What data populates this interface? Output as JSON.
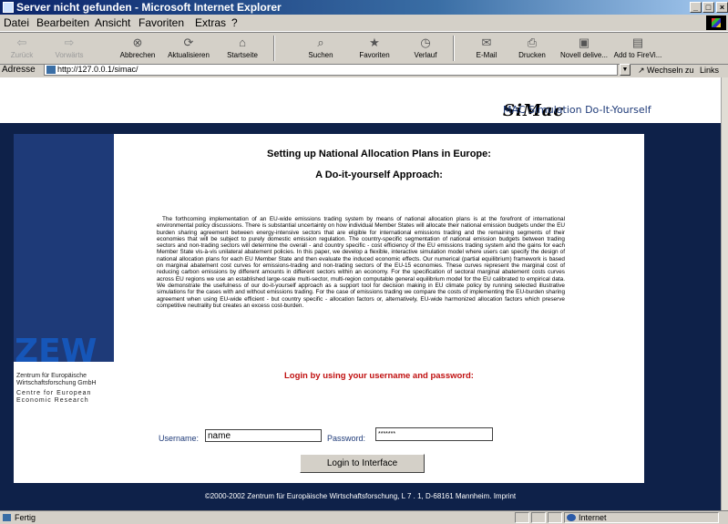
{
  "window": {
    "title": "Server nicht gefunden - Microsoft Internet Explorer"
  },
  "menu": [
    "Datei",
    "Bearbeiten",
    "Ansicht",
    "Favoriten",
    "Extras",
    "?"
  ],
  "toolbar": {
    "back": "Zurück",
    "forward": "Vorwärts",
    "stop": "Abbrechen",
    "refresh": "Aktualisieren",
    "home": "Startseite",
    "search": "Suchen",
    "favorites": "Favoriten",
    "history": "Verlauf",
    "mail": "E-Mail",
    "print": "Drucken",
    "novell": "Novell delive...",
    "firevi": "Add to FireVi..."
  },
  "address": {
    "label": "Adresse",
    "url": "http://127.0.0.1/simac/",
    "go": "Wechseln zu",
    "links": "Links"
  },
  "logo": {
    "brand": "SiMac",
    "subtitle": "MAC Simulation Do-It-Yourself"
  },
  "zew": {
    "logo": "ZEW",
    "german": "Zentrum für Europäische Wirtschaftsforschung GmbH",
    "english": "Centre for European Economic Research"
  },
  "page": {
    "heading1": "Setting up National Allocation Plans in Europe:",
    "heading2": "A Do-it-yourself Approach:",
    "abstract": "The forthcoming implementation of an EU-wide emissions trading system by means of national allocation plans is at the forefront of international environmental policy discussions. There is substantial uncertainty on how individual Member States will allocate their national emission budgets under the EU burden sharing agreement between energy-intensive sectors that are eligible for international emissions trading and the remaining segments of their economies that will be subject to purely domestic emission regulation. The country-specific segmentation of national emission budgets between trading sectors and non-trading sectors will determine the overall - and country specific - cost efficiency of the EU emissions trading system and the gains for each Member State vis-à-vis unilateral abatement policies. In this paper, we develop a flexible, interactive simulation model where users can specify the design of national allocation plans for each EU Member State and then evaluate the induced economic effects. Our numerical (partial equilibrium) framework is based on marginal abatement cost curves for emissions-trading and non-trading sectors of the EU-15 economies. These curves represent the marginal cost of reducing carbon emissions by different amounts in different sectors within an economy. For the specification of sectoral marginal abatement costs curves across EU regions we use an established large-scale multi-sector, multi-region computable general equilibrium model for the EU calibrated to empirical data. We demonstrate the usefulness of our do-it-yourself approach as a support tool for decision making in EU climate policy by running selected illustrative simulations for the cases with and without emissions trading. For the case of emissions trading we compare the costs of implementing the EU-burden sharing agreement when using EU-wide efficient - but country specific - allocation factors or, alternatively, EU-wide harmonized allocation factors which preserve competitive neutrality but creates an excess cost-burden.",
    "login_message": "Login by using your username and password:"
  },
  "form": {
    "username_label": "Username:",
    "username_value": "name",
    "password_label": "Password:",
    "password_value": "*******",
    "login_button": "Login to Interface"
  },
  "footer": {
    "text": "©2000-2002 Zentrum für Europäische Wirtschaftsforschung, L 7 . 1, D-68161 Mannheim.  Imprint"
  },
  "status": {
    "text": "Fertig",
    "zone": "Internet"
  }
}
